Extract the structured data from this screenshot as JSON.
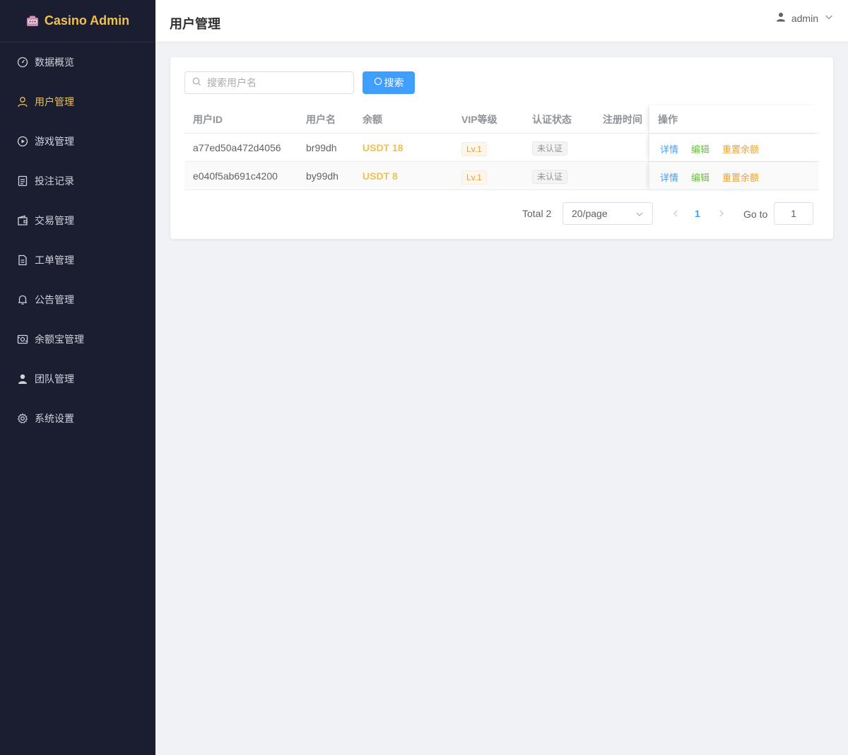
{
  "app": {
    "title": "Casino Admin",
    "brand_color": "#f0c14b",
    "logo_icon": "slot-machine-icon"
  },
  "sidebar": {
    "items": [
      {
        "label": "数据概览",
        "icon": "dashboard-icon",
        "active": false
      },
      {
        "label": "用户管理",
        "icon": "user-icon",
        "active": true
      },
      {
        "label": "游戏管理",
        "icon": "play-icon",
        "active": false
      },
      {
        "label": "投注记录",
        "icon": "document-icon",
        "active": false
      },
      {
        "label": "交易管理",
        "icon": "wallet-icon",
        "active": false
      },
      {
        "label": "工单管理",
        "icon": "ticket-icon",
        "active": false
      },
      {
        "label": "公告管理",
        "icon": "bell-icon",
        "active": false
      },
      {
        "label": "余额宝管理",
        "icon": "money-icon",
        "active": false
      },
      {
        "label": "团队管理",
        "icon": "team-icon",
        "active": false
      },
      {
        "label": "系统设置",
        "icon": "gear-icon",
        "active": false
      }
    ]
  },
  "header": {
    "title": "用户管理",
    "user": "admin"
  },
  "search": {
    "placeholder": "搜索用户名",
    "button": "搜索"
  },
  "table": {
    "headers": [
      "用户ID",
      "用户名",
      "余额",
      "VIP等级",
      "认证状态",
      "注册时间",
      "操作"
    ],
    "rows": [
      {
        "id": "a77ed50a472d4056",
        "username": "br99dh",
        "balance": "USDT 18",
        "vip": "Lv.1",
        "auth": "未认证",
        "registered": ""
      },
      {
        "id": "e040f5ab691c4200",
        "username": "by99dh",
        "balance": "USDT 8",
        "vip": "Lv.1",
        "auth": "未认证",
        "registered": ""
      }
    ],
    "actions": {
      "detail": "详情",
      "edit": "编辑",
      "reset": "重置余额"
    }
  },
  "pagination": {
    "total": "Total 2",
    "page_size": "20/page",
    "current_page": "1",
    "goto_label": "Go to",
    "goto_value": "1"
  }
}
